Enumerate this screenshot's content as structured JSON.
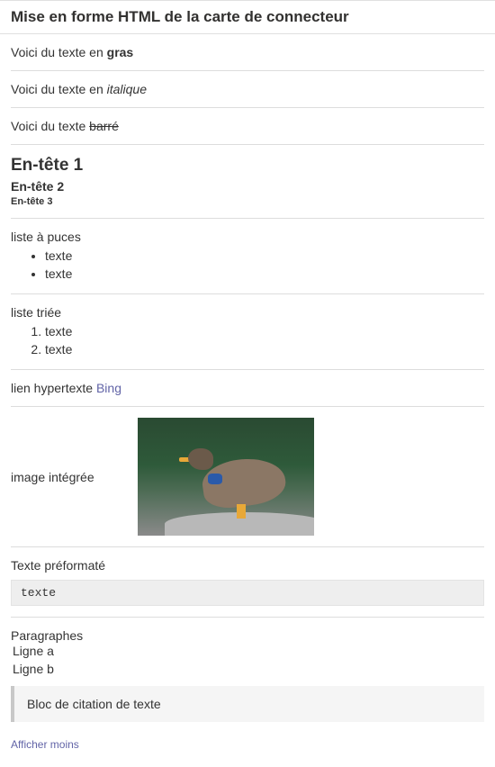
{
  "title": "Mise en forme HTML de la carte de connecteur",
  "bold_line": {
    "prefix": "Voici du texte en ",
    "word": "gras"
  },
  "italic_line": {
    "prefix": "Voici du texte en ",
    "word": "italique"
  },
  "strike_line": {
    "prefix": "Voici du texte ",
    "word": "barré"
  },
  "headers": {
    "h1": "En-tête 1",
    "h2": "En-tête 2",
    "h3": "En-tête 3"
  },
  "bullet": {
    "title": "liste à puces",
    "items": [
      "texte",
      "texte"
    ]
  },
  "ordered": {
    "title": "liste triée",
    "items": [
      "texte",
      "texte"
    ]
  },
  "hyperlink": {
    "prefix": "lien hypertexte ",
    "link_text": "Bing"
  },
  "image": {
    "label": "image intégrée"
  },
  "preformatted": {
    "title": "Texte préformaté",
    "code": "texte"
  },
  "paragraphs": {
    "title": "Paragraphes",
    "lines": [
      "Ligne a",
      "Ligne b"
    ]
  },
  "blockquote": "Bloc de citation de texte",
  "show_less": "Afficher moins"
}
